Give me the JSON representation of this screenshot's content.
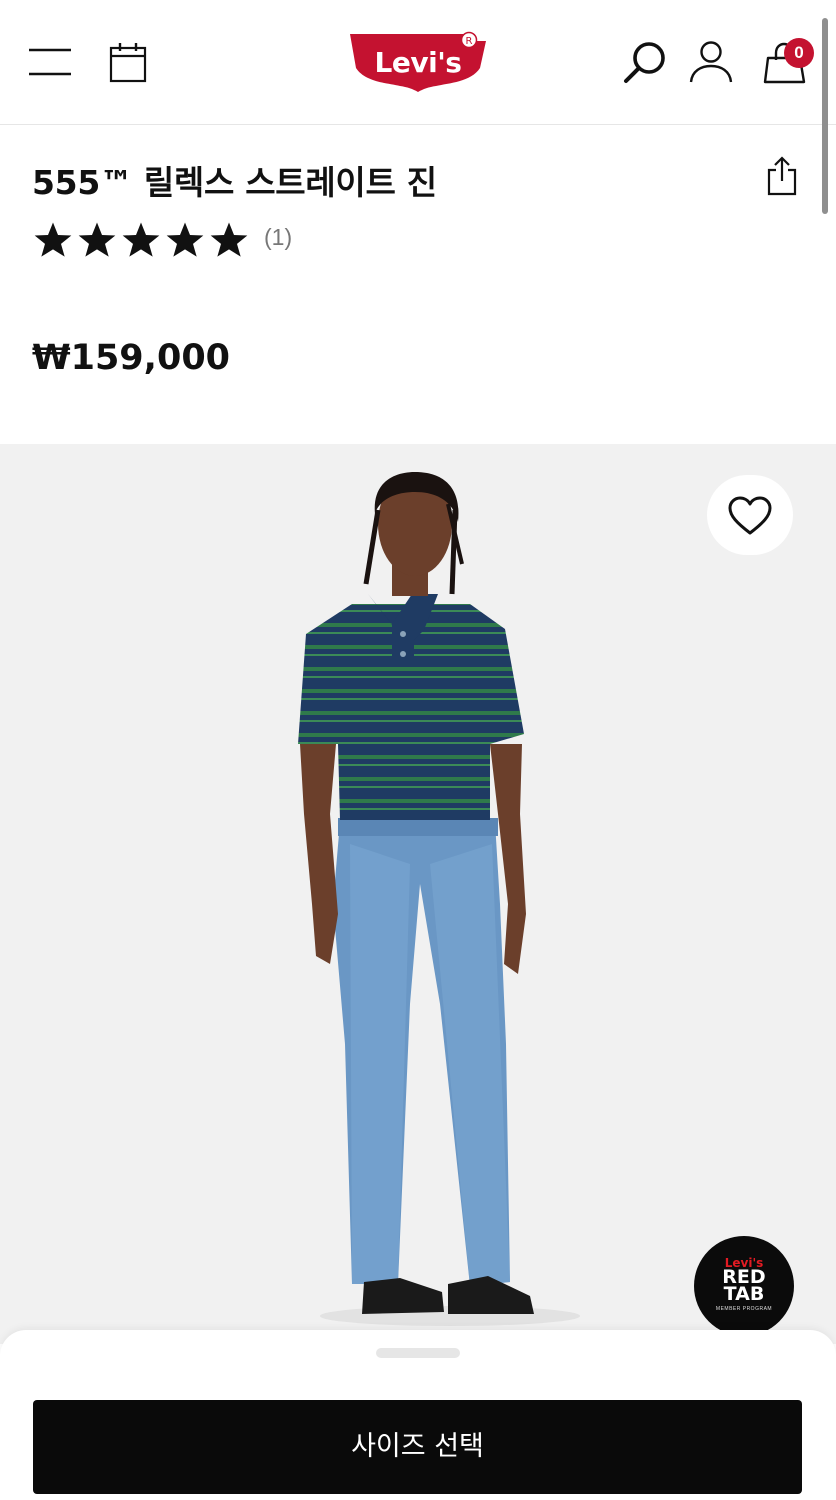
{
  "header": {
    "logo_text": "Levi's",
    "cart_count": "0",
    "brand_color": "#c41230",
    "icons": [
      "menu-icon",
      "calendar-icon",
      "search-icon",
      "account-icon",
      "bag-icon"
    ]
  },
  "product": {
    "name": "555™ 릴렉스 스트레이트 진",
    "rating": 5,
    "rating_max": 5,
    "review_count": "(1)",
    "price": "₩159,000"
  },
  "hero": {
    "wishlist_icon": "heart-icon",
    "redtab_brand": "Levi's",
    "redtab_line1": "RED",
    "redtab_line2": "TAB",
    "redtab_sub": "MEMBER PROGRAM"
  },
  "sheet": {
    "cta_label": "사이즈 선택"
  }
}
